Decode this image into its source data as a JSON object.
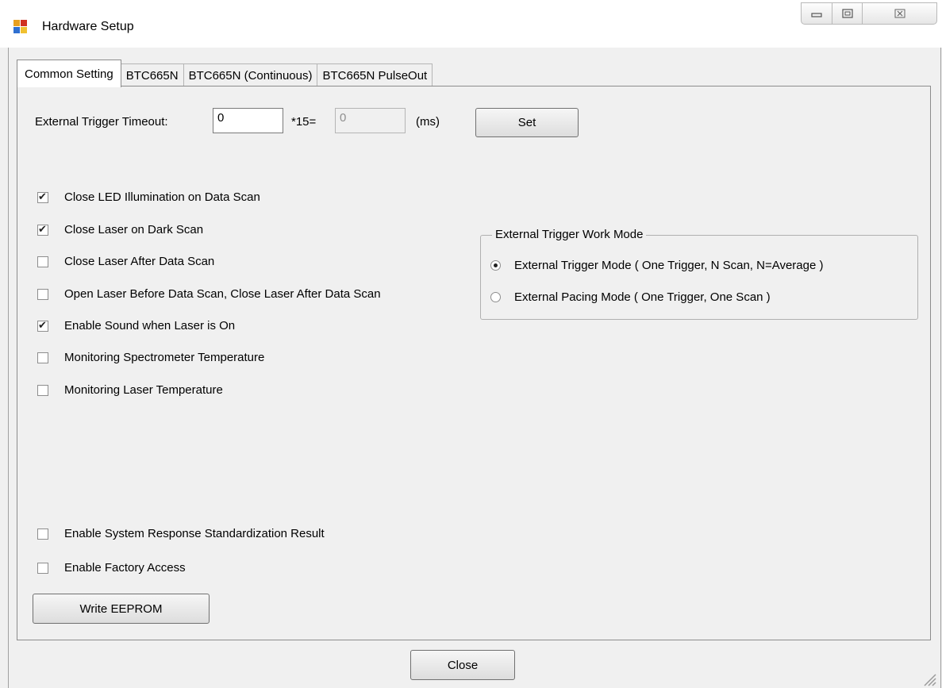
{
  "window": {
    "title": "Hardware Setup",
    "caption_buttons": [
      "minimize-icon",
      "maximize-icon",
      "close-icon"
    ],
    "close_glyph": "☒"
  },
  "tabs": [
    {
      "label": "Common Setting",
      "active": true
    },
    {
      "label": "BTC665N",
      "active": false
    },
    {
      "label": "BTC665N (Continuous)",
      "active": false
    },
    {
      "label": "BTC665N PulseOut",
      "active": false
    }
  ],
  "trigger_timeout": {
    "label": "External Trigger Timeout:",
    "value": "0",
    "multiplier_label": "*15=",
    "result_value": "0",
    "unit_label": "(ms)",
    "set_button": "Set"
  },
  "checkboxes": [
    {
      "label": "Close LED Illumination on Data Scan",
      "checked": true
    },
    {
      "label": "Close Laser on Dark Scan",
      "checked": true
    },
    {
      "label": "Close Laser After Data Scan",
      "checked": false
    },
    {
      "label": "Open Laser Before Data Scan, Close Laser After Data Scan",
      "checked": false
    },
    {
      "label": "Enable Sound when Laser is On",
      "checked": true
    },
    {
      "label": "Monitoring Spectrometer Temperature",
      "checked": false
    },
    {
      "label": "Monitoring Laser Temperature",
      "checked": false
    }
  ],
  "trigger_mode": {
    "title": "External Trigger Work Mode",
    "options": [
      {
        "label": "External Trigger Mode ( One Trigger, N Scan, N=Average )",
        "selected": true
      },
      {
        "label": "External Pacing Mode ( One Trigger, One Scan )",
        "selected": false
      }
    ]
  },
  "bottom_checkboxes": [
    {
      "label": "Enable System Response Standardization Result",
      "checked": false
    },
    {
      "label": "Enable Factory Access",
      "checked": false
    }
  ],
  "write_eeprom_button": "Write EEPROM",
  "close_button": "Close"
}
